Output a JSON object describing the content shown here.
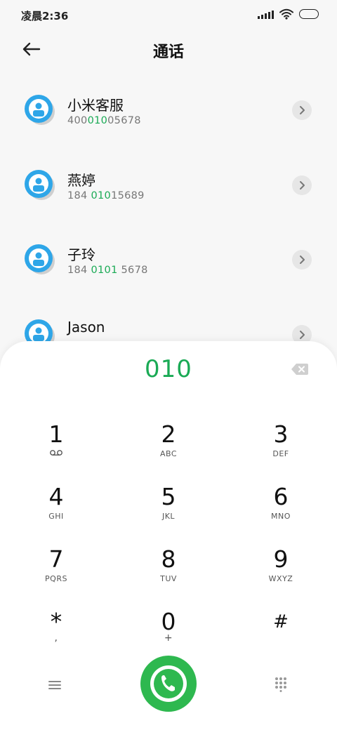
{
  "status_bar": {
    "time": "凌晨2:36",
    "icons": [
      "signal-icon",
      "wifi-icon",
      "battery-icon"
    ]
  },
  "header": {
    "title": "通话",
    "back_icon": "arrow-left-icon"
  },
  "contacts": [
    {
      "name": "小米客服",
      "number_parts": [
        "400",
        "010",
        "05678"
      ]
    },
    {
      "name": "燕婷",
      "number_parts": [
        "184 ",
        "010",
        "15689"
      ]
    },
    {
      "name": "子玲",
      "number_parts": [
        "184 ",
        "0101",
        " 5678"
      ]
    },
    {
      "name": "Jason",
      "number_parts": [
        "",
        "",
        ""
      ]
    }
  ],
  "dialpad": {
    "input": "010",
    "keys": [
      {
        "digit": "1",
        "letters": ""
      },
      {
        "digit": "2",
        "letters": "ABC"
      },
      {
        "digit": "3",
        "letters": "DEF"
      },
      {
        "digit": "4",
        "letters": "GHI"
      },
      {
        "digit": "5",
        "letters": "JKL"
      },
      {
        "digit": "6",
        "letters": "MNO"
      },
      {
        "digit": "7",
        "letters": "PQRS"
      },
      {
        "digit": "8",
        "letters": "TUV"
      },
      {
        "digit": "9",
        "letters": "WXYZ"
      },
      {
        "digit": "*",
        "letters": ","
      },
      {
        "digit": "0",
        "letters": "+"
      },
      {
        "digit": "#",
        "letters": ""
      }
    ]
  },
  "colors": {
    "accent": "#1aaa55",
    "call_button": "#2eb84f",
    "avatar": "#2ea6e8"
  }
}
